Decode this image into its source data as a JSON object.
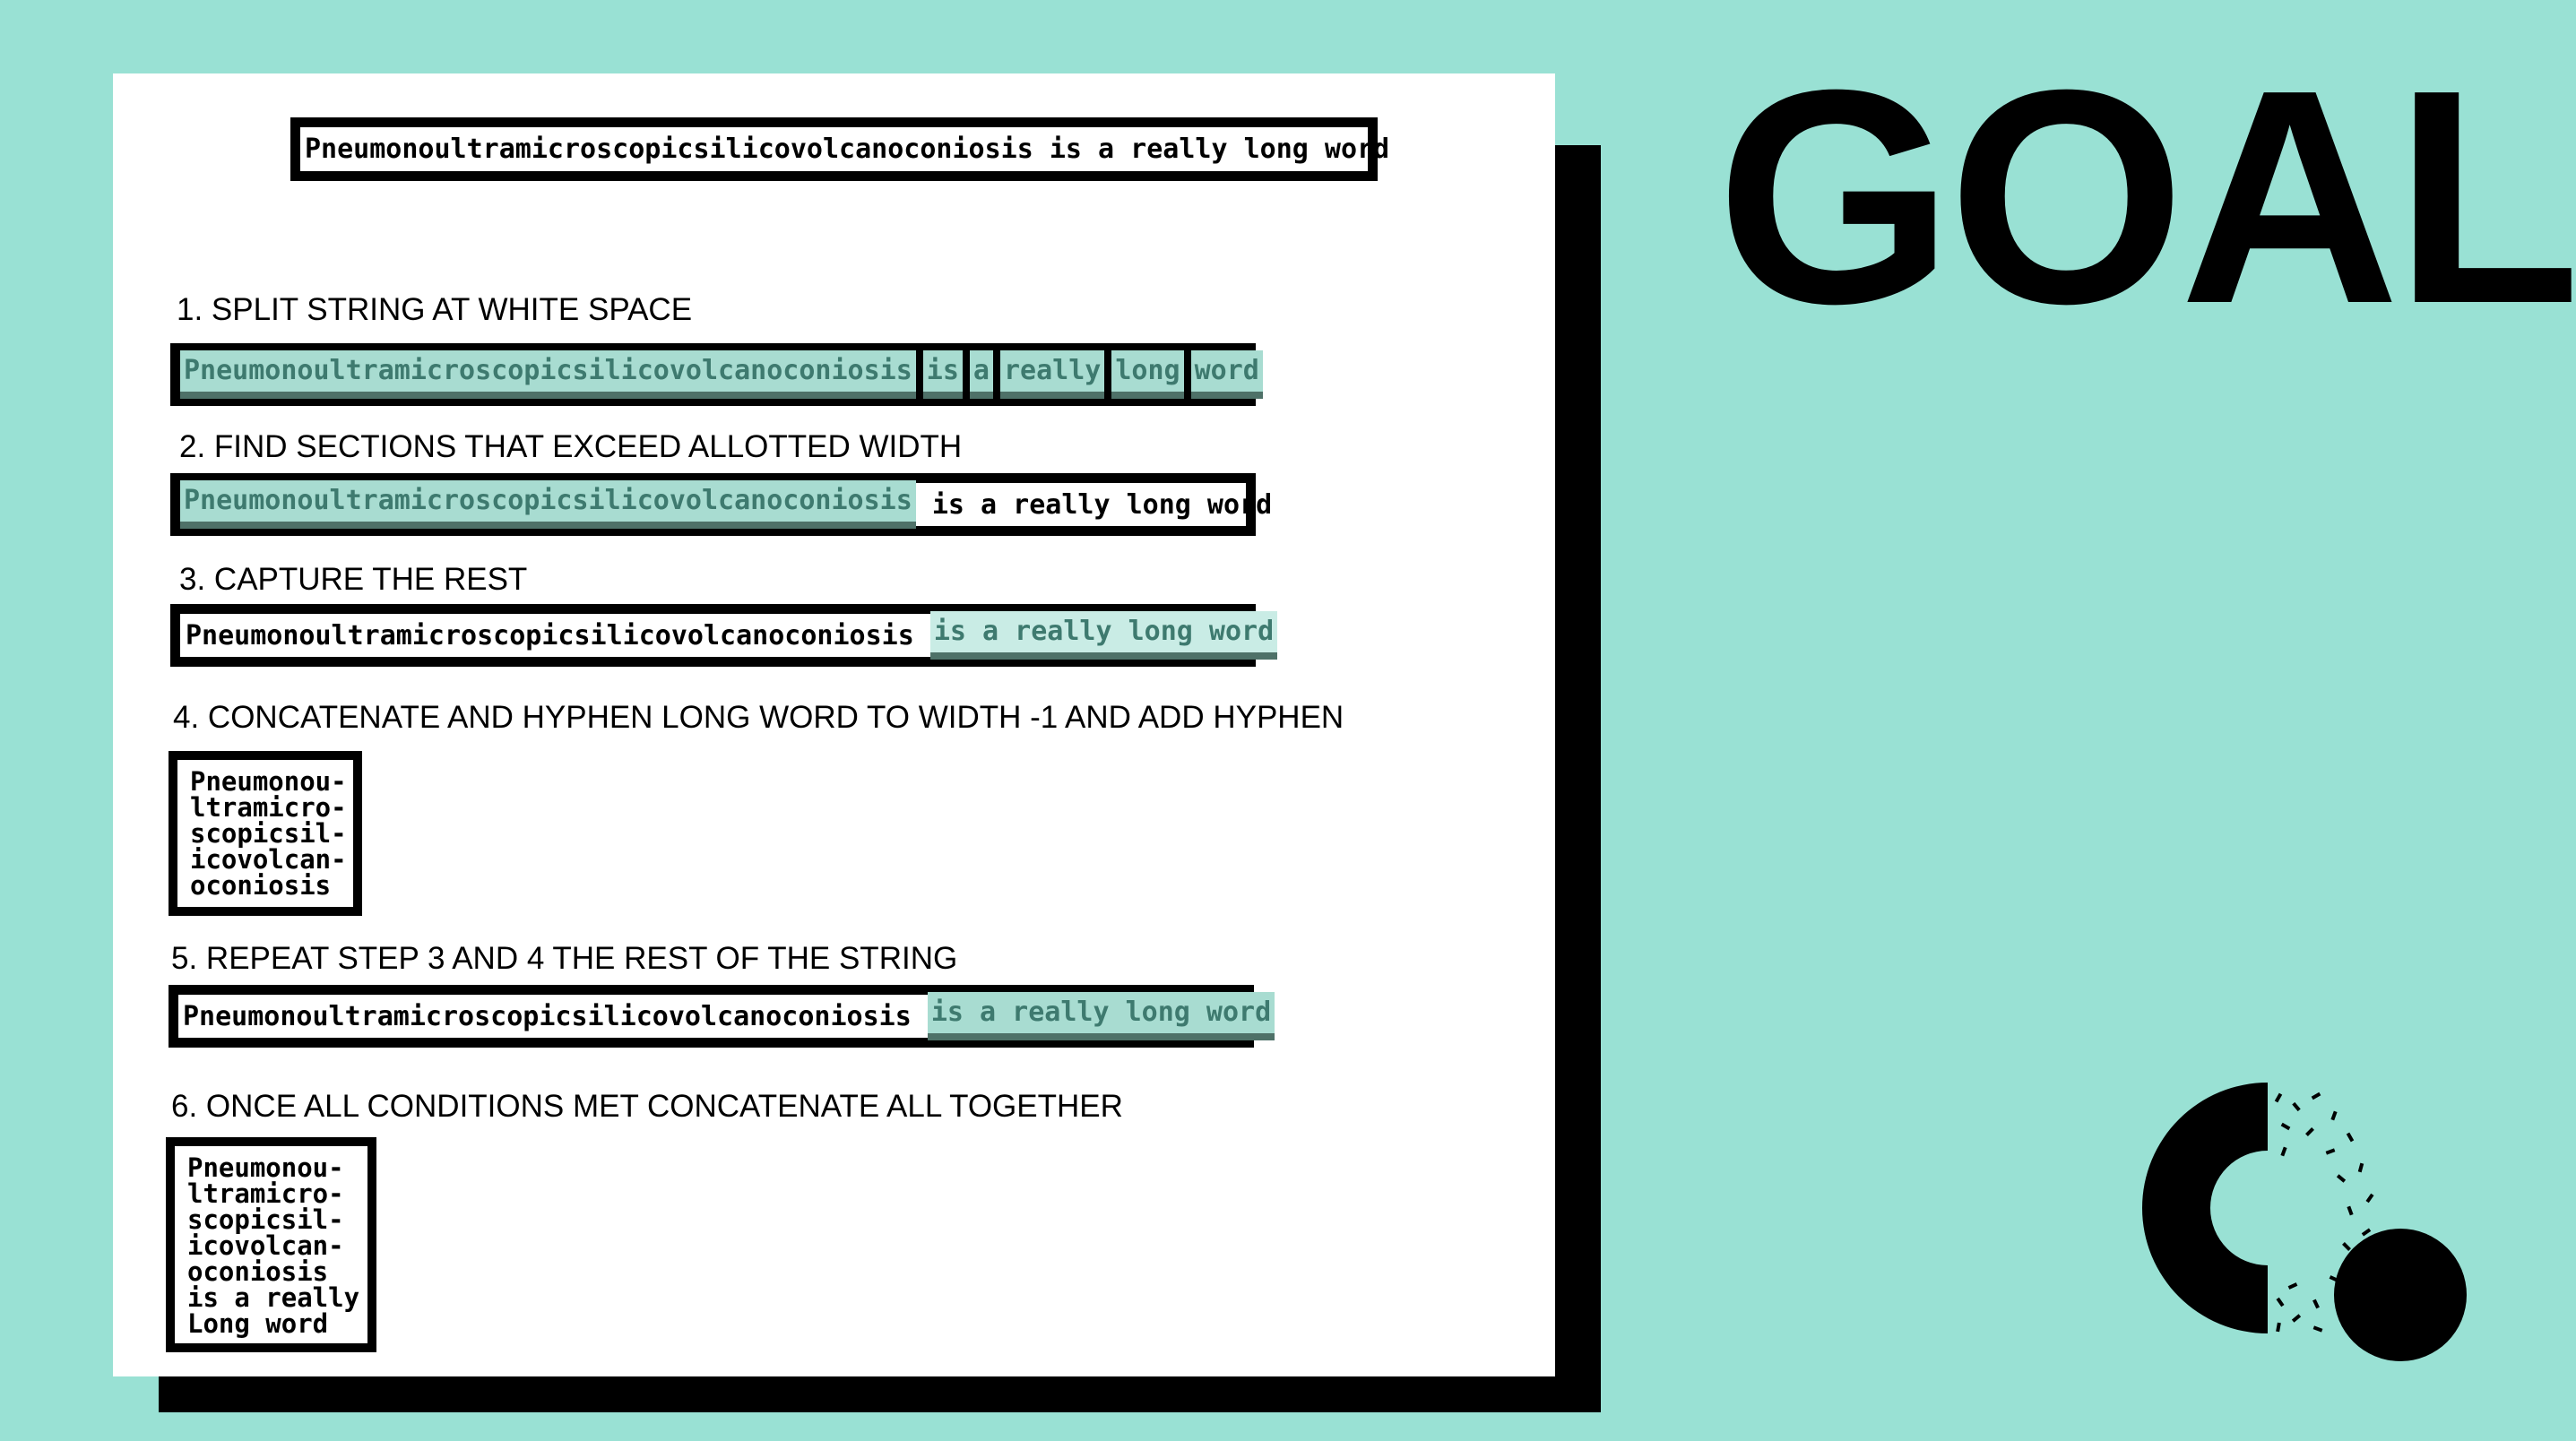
{
  "header_text": "Pneumonoultramicroscopicsilicovolcanoconiosis is a really long word",
  "goal_title": "GOAL",
  "steps": [
    {
      "label": "1. SPLIT STRING AT WHITE SPACE",
      "segments": [
        "Pneumonoultramicroscopicsilicovolcanoconiosis",
        "is",
        "a",
        "really",
        "long",
        "word"
      ]
    },
    {
      "label": "2. FIND SECTIONS THAT EXCEED ALLOTTED WIDTH",
      "highlight": "Pneumonoultramicroscopicsilicovolcanoconiosis",
      "rest": " is a really long word"
    },
    {
      "label": "3. CAPTURE THE REST",
      "plain": "Pneumonoultramicroscopicsilicovolcanoconiosis ",
      "highlight": "is a really long word"
    },
    {
      "label": "4. CONCATENATE AND HYPHEN LONG WORD TO WIDTH -1 AND ADD HYPHEN",
      "lines": [
        "Pneumonou-",
        "ltramicro-",
        "scopicsil-",
        "icovolcan-",
        "oconiosis"
      ]
    },
    {
      "label": "5. REPEAT STEP 3 AND 4 THE REST OF THE STRING",
      "plain": "Pneumonoultramicroscopicsilicovolcanoconiosis ",
      "highlight": "is a really long word"
    },
    {
      "label": "6. ONCE ALL CONDITIONS MET CONCATENATE ALL TOGETHER",
      "lines": [
        "Pneumonou-",
        "ltramicro-",
        "scopicsil-",
        "icovolcan-",
        "oconiosis",
        "is a really",
        "Long word"
      ]
    }
  ],
  "colors": {
    "background": "#99e1d4",
    "highlight": "#a8dcd1",
    "highlight_text": "#3e7a6f",
    "highlight_underline": "#4e7168"
  },
  "logo_icon": "broken-ring-with-dot-logo"
}
